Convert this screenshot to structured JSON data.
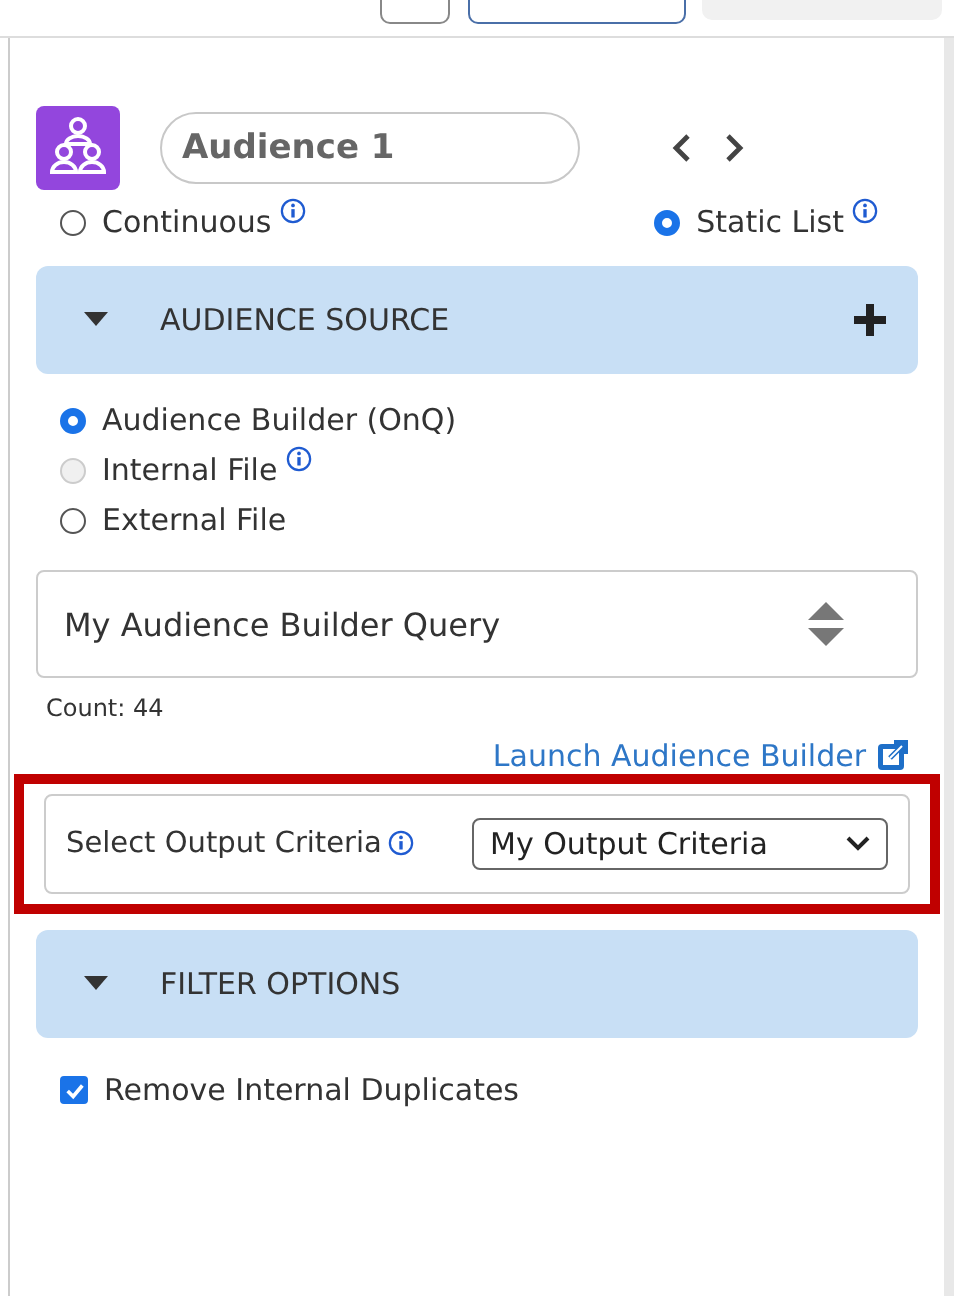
{
  "audience": {
    "name": "Audience 1"
  },
  "list_types": [
    {
      "label": "Continuous",
      "selected": false,
      "info": true
    },
    {
      "label": "Static List",
      "selected": true,
      "info": true
    }
  ],
  "sections": [
    {
      "title": "AUDIENCE SOURCE",
      "expanded": true,
      "addable": true
    },
    {
      "title": "FILTER OPTIONS",
      "expanded": true,
      "addable": false
    }
  ],
  "sources": [
    {
      "label": "Audience Builder (OnQ)",
      "selected": true,
      "disabled": false,
      "info": false
    },
    {
      "label": "Internal File",
      "selected": false,
      "disabled": true,
      "info": true
    },
    {
      "label": "External File",
      "selected": false,
      "disabled": false,
      "info": false
    }
  ],
  "query_select": {
    "value": "My Audience Builder Query"
  },
  "count": "Count: 44",
  "launch_link": "Launch Audience Builder",
  "output_criteria": {
    "label": "Select Output Criteria",
    "value": "My Output Criteria",
    "highlighted": true
  },
  "filters": [
    {
      "label": "Remove Internal Duplicates",
      "checked": true
    }
  ]
}
